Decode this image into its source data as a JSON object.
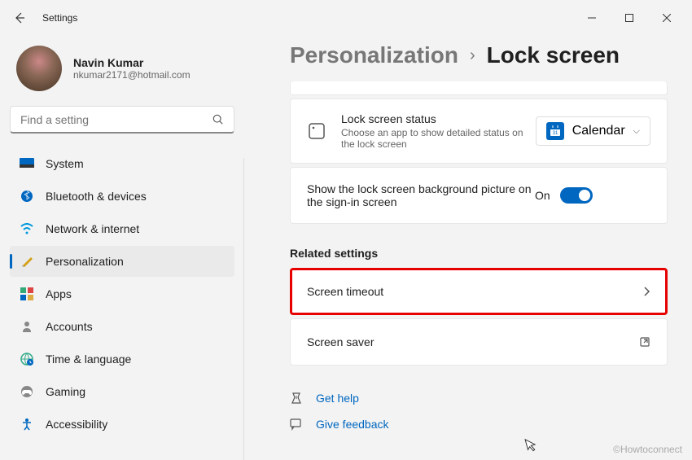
{
  "titlebar": {
    "title": "Settings"
  },
  "profile": {
    "name": "Navin Kumar",
    "email": "nkumar2171@hotmail.com"
  },
  "search": {
    "placeholder": "Find a setting"
  },
  "nav": [
    {
      "icon": "system",
      "label": "System"
    },
    {
      "icon": "bluetooth",
      "label": "Bluetooth & devices"
    },
    {
      "icon": "wifi",
      "label": "Network & internet"
    },
    {
      "icon": "brush",
      "label": "Personalization"
    },
    {
      "icon": "apps",
      "label": "Apps"
    },
    {
      "icon": "person",
      "label": "Accounts"
    },
    {
      "icon": "globe",
      "label": "Time & language"
    },
    {
      "icon": "gaming",
      "label": "Gaming"
    },
    {
      "icon": "accessibility",
      "label": "Accessibility"
    }
  ],
  "breadcrumb": {
    "parent": "Personalization",
    "current": "Lock screen"
  },
  "lockStatus": {
    "title": "Lock screen status",
    "desc": "Choose an app to show detailed status on the lock screen",
    "selected": "Calendar"
  },
  "toggle": {
    "label": "Show the lock screen background picture on the sign-in screen",
    "state": "On"
  },
  "related": {
    "heading": "Related settings",
    "items": [
      {
        "label": "Screen timeout",
        "highlighted": true
      },
      {
        "label": "Screen saver",
        "external": true
      }
    ]
  },
  "footer": {
    "help": "Get help",
    "feedback": "Give feedback"
  },
  "watermark": "©Howtoconnect"
}
